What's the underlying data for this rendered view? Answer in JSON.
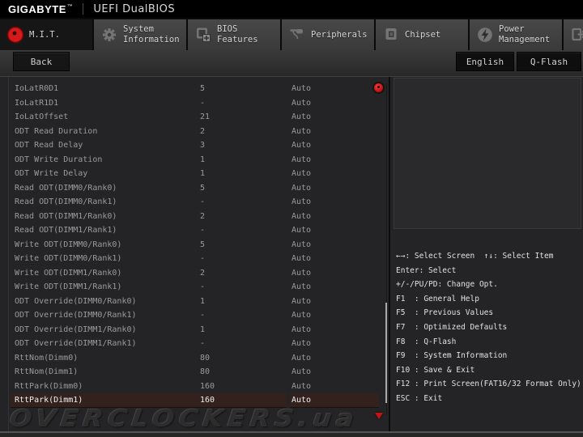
{
  "header": {
    "brand": "GIGABYTE",
    "trademark": "™",
    "title": "UEFI DualBIOS"
  },
  "tabs": [
    {
      "label": "M.I.T.",
      "icon": "gauge-icon",
      "active": true
    },
    {
      "label": "System Information",
      "icon": "gear-icon",
      "active": false
    },
    {
      "label": "BIOS Features",
      "icon": "bios-chip-icon",
      "active": false
    },
    {
      "label": "Peripherals",
      "icon": "peripherals-icon",
      "active": false
    },
    {
      "label": "Chipset",
      "icon": "chipset-icon",
      "active": false
    },
    {
      "label": "Power Management",
      "icon": "power-bolt-icon",
      "active": false
    },
    {
      "label": "Save & Exit",
      "icon": "exit-icon",
      "active": false
    }
  ],
  "toolbar": {
    "back": "Back",
    "language": "English",
    "qflash": "Q-Flash"
  },
  "settings": {
    "selected_index": 22,
    "rows": [
      {
        "name": "IoLatR0D1",
        "value": "5",
        "mode": "Auto"
      },
      {
        "name": "IoLatR1D1",
        "value": "-",
        "mode": "Auto"
      },
      {
        "name": "IoLatOffset",
        "value": "21",
        "mode": "Auto"
      },
      {
        "name": "ODT Read Duration",
        "value": "2",
        "mode": "Auto"
      },
      {
        "name": "ODT Read Delay",
        "value": "3",
        "mode": "Auto"
      },
      {
        "name": "ODT Write Duration",
        "value": "1",
        "mode": "Auto"
      },
      {
        "name": "ODT Write Delay",
        "value": "1",
        "mode": "Auto"
      },
      {
        "name": "Read ODT(DIMM0/Rank0)",
        "value": "5",
        "mode": "Auto"
      },
      {
        "name": "Read ODT(DIMM0/Rank1)",
        "value": "-",
        "mode": "Auto"
      },
      {
        "name": "Read ODT(DIMM1/Rank0)",
        "value": "2",
        "mode": "Auto"
      },
      {
        "name": "Read ODT(DIMM1/Rank1)",
        "value": "-",
        "mode": "Auto"
      },
      {
        "name": "Write ODT(DIMM0/Rank0)",
        "value": "5",
        "mode": "Auto"
      },
      {
        "name": "Write ODT(DIMM0/Rank1)",
        "value": "-",
        "mode": "Auto"
      },
      {
        "name": "Write ODT(DIMM1/Rank0)",
        "value": "2",
        "mode": "Auto"
      },
      {
        "name": "Write ODT(DIMM1/Rank1)",
        "value": "-",
        "mode": "Auto"
      },
      {
        "name": "ODT Override(DIMM0/Rank0)",
        "value": "1",
        "mode": "Auto"
      },
      {
        "name": "ODT Override(DIMM0/Rank1)",
        "value": "-",
        "mode": "Auto"
      },
      {
        "name": "ODT Override(DIMM1/Rank0)",
        "value": "1",
        "mode": "Auto"
      },
      {
        "name": "ODT Override(DIMM1/Rank1)",
        "value": "-",
        "mode": "Auto"
      },
      {
        "name": "RttNom(Dimm0)",
        "value": "80",
        "mode": "Auto"
      },
      {
        "name": "RttNom(Dimm1)",
        "value": "80",
        "mode": "Auto"
      },
      {
        "name": "RttPark(Dimm0)",
        "value": "160",
        "mode": "Auto"
      },
      {
        "name": "RttPark(Dimm1)",
        "value": "160",
        "mode": "Auto"
      }
    ]
  },
  "help": {
    "lines": [
      "←→: Select Screen  ↑↓: Select Item",
      "Enter: Select",
      "+/-/PU/PD: Change Opt.",
      "F1  : General Help",
      "F5  : Previous Values",
      "F7  : Optimized Defaults",
      "F8  : Q-Flash",
      "F9  : System Information",
      "F10 : Save & Exit",
      "F12 : Print Screen(FAT16/32 Format Only)",
      "ESC : Exit"
    ]
  },
  "watermark": "OVERCLOCKERS.ua",
  "colors": {
    "accent_red": "#d41a1a",
    "selected_row_bg": "#33211d",
    "tab_inactive": "#3f3f3f"
  }
}
